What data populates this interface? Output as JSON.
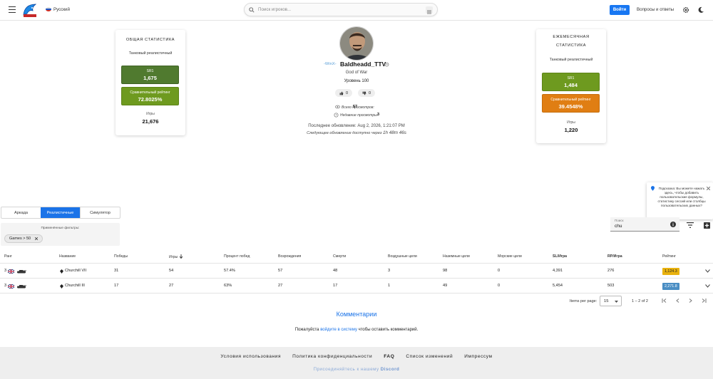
{
  "header": {
    "language": "Русский",
    "search_placeholder": "Поиск игроков...",
    "login_label": "Войти",
    "faq_label": "Вопросы и ответы"
  },
  "overall_card": {
    "title": "ОБЩАЯ СТАТИСТИКА",
    "subtitle": "Танковый реалистичный",
    "sr1_label": "SR1",
    "sr1_value": "1,675",
    "rating_label": "Сравнительный рейтинг",
    "rating_value": "72.8025%",
    "games_label": "Игры",
    "games_value": "21,676"
  },
  "monthly_card": {
    "title_line1": "ЕЖЕМЕСЯЧНАЯ",
    "title_line2": "СТАТИСТИКА",
    "subtitle": "Танковый реалистичный",
    "sr1_label": "SR1",
    "sr1_value": "1,484",
    "rating_label": "Сравнительный рейтинг",
    "rating_value": "39.4548%",
    "games_label": "Игры",
    "games_value": "1,220"
  },
  "profile": {
    "clan": "-WinX-",
    "name": "Baldheadd_TTV",
    "title": "God of War",
    "level": "Уровень 100",
    "likes": "0",
    "dislikes": "0",
    "total_views_label": "Всего просмотров:",
    "total_views": "57",
    "recent_views_label": "Недавние просмотры:",
    "recent_views": "3",
    "last_update": "Последнее обновление: Aug 2, 2026, 1:21:07 PM",
    "next_update_label": "Следующее обновление доступно через",
    "next_update_time": "1h 48m 46s"
  },
  "mode_tabs": [
    "Аркада",
    "Реалистичные",
    "Симулятор"
  ],
  "filters": {
    "label": "Применённые фильтры:",
    "chip": "Games > 50"
  },
  "table_search": {
    "label": "Поиск",
    "value": "chu"
  },
  "tip": {
    "text": "Подсказка: Вы можете нажать здесь, чтобы добавить пользовательские формулы, статистику сессий или столбцы пользовательских данных?"
  },
  "table": {
    "headers": [
      "Ранг",
      "Название",
      "Победы",
      "Игры",
      "Процент побед",
      "Возрождения",
      "Смерти",
      "Воздушные цели",
      "Наземные цели",
      "Морские цели",
      "SL/Игра",
      "RP/Игра",
      "Рейтинг"
    ],
    "rows": [
      {
        "rank": "3",
        "name": "Churchill VII",
        "wins": "31",
        "games": "54",
        "winrate": "57.4%",
        "respawns": "57",
        "deaths": "48",
        "air": "3",
        "ground": "98",
        "naval": "0",
        "sl": "4,391",
        "rp": "276",
        "rating": "1,124.3",
        "rating_color": "#e9b20e"
      },
      {
        "rank": "3",
        "name": "Churchill III",
        "wins": "17",
        "games": "27",
        "winrate": "63%",
        "respawns": "27",
        "deaths": "17",
        "air": "1",
        "ground": "49",
        "naval": "0",
        "sl": "5,454",
        "rp": "503",
        "rating": "2,271.8",
        "rating_color": "#4a8ec4"
      }
    ]
  },
  "pagination": {
    "items_label": "Items per page:",
    "per_page": "15",
    "range": "1 – 2 of 2"
  },
  "comments": {
    "title": "Комментарии",
    "prefix": "Пожалуйста",
    "link": "войдите в систему",
    "suffix": "чтобы оставить комментарий."
  },
  "footer": {
    "links": [
      "Условия использования",
      "Политика конфиденциальности",
      "FAQ",
      "Список изменений",
      "Импрессум"
    ],
    "discord_prefix": "Присоединяйтесь к нашему",
    "discord_word": "Discord"
  }
}
